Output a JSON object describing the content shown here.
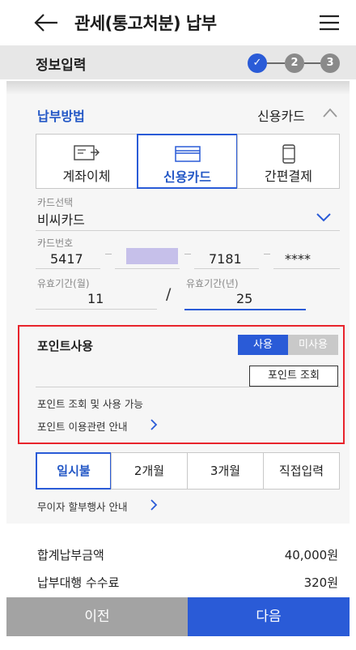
{
  "header": {
    "title": "관세(통고처분) 납부",
    "back_icon": "arrow-left-icon",
    "menu_icon": "hamburger-menu-icon"
  },
  "stepbar": {
    "label": "정보입력",
    "steps": [
      "✓",
      "2",
      "3"
    ],
    "active_color": "#2a5bd7",
    "inactive_color": "#8a8a8a"
  },
  "payment": {
    "method_label": "납부방법",
    "method_value": "신용카드",
    "tabs": [
      {
        "label": "계좌이체",
        "icon": "account-transfer-icon"
      },
      {
        "label": "신용카드",
        "icon": "credit-card-icon",
        "active": true
      },
      {
        "label": "간편결제",
        "icon": "mobile-phone-icon"
      }
    ]
  },
  "card": {
    "select_label": "카드선택",
    "select_value": "비씨카드",
    "number_label": "카드번호",
    "number_segments": [
      "5417",
      "",
      "7181",
      "****"
    ],
    "exp_month_label": "유효기간(월)",
    "exp_month_value": "11",
    "exp_year_label": "유효기간(년)",
    "exp_year_value": "25",
    "separator": "/"
  },
  "points": {
    "title": "포인트사용",
    "use_label": "사용",
    "nouse_label": "미사용",
    "query_button": "포인트 조회",
    "available_text": "포인트 조회 및 사용 가능",
    "guide_text": "포인트 이용관련 안내"
  },
  "installment": {
    "tabs": [
      "일시불",
      "2개월",
      "3개월",
      "직접입력"
    ],
    "active_index": 0,
    "interest_free_text": "무이자 할부행사 안내"
  },
  "summary": {
    "total_label": "합계납부금액",
    "total_value": "40,000원",
    "fee_label": "납부대행 수수료",
    "fee_value": "320원"
  },
  "bottom": {
    "prev_label": "이전",
    "next_label": "다음"
  },
  "colors": {
    "accent": "#2a5bd7",
    "highlight_border": "#e8242c"
  }
}
